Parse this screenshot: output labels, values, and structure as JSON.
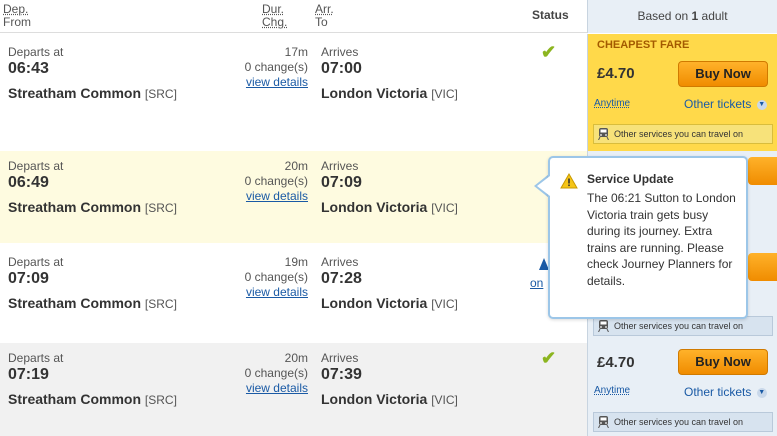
{
  "header": {
    "dep_abbr": "Dep.",
    "from": "From",
    "dur_abbr": "Dur.",
    "chg_abbr": "Chg.",
    "arr_abbr": "Arr.",
    "to": "To",
    "status": "Status",
    "fare_prefix": "Based on ",
    "fare_count": "1",
    "fare_suffix": " adult"
  },
  "rows": [
    {
      "departs_label": "Departs at",
      "dep_time": "06:43",
      "dep_station": "Streatham Common",
      "dep_code": "[SRC]",
      "duration": "17m",
      "changes": "0 change(s)",
      "view_details": "view details",
      "arrives_label": "Arrives",
      "arr_time": "07:00",
      "arr_station": "London Victoria",
      "arr_code": "[VIC]",
      "status_icon": "check-icon",
      "status_symbol": "✔"
    },
    {
      "departs_label": "Departs at",
      "dep_time": "06:49",
      "dep_station": "Streatham Common",
      "dep_code": "[SRC]",
      "duration": "20m",
      "changes": "0 change(s)",
      "view_details": "view details",
      "arrives_label": "Arrives",
      "arr_time": "07:09",
      "arr_station": "London Victoria",
      "arr_code": "[VIC]"
    },
    {
      "departs_label": "Departs at",
      "dep_time": "07:09",
      "dep_station": "Streatham Common",
      "dep_code": "[SRC]",
      "duration": "19m",
      "changes": "0 change(s)",
      "view_details": "view details",
      "arrives_label": "Arrives",
      "arr_time": "07:28",
      "arr_station": "London Victoria",
      "arr_code": "[VIC]",
      "status_link_partial": "on"
    },
    {
      "departs_label": "Departs at",
      "dep_time": "07:19",
      "dep_station": "Streatham Common",
      "dep_code": "[SRC]",
      "duration": "20m",
      "changes": "0 change(s)",
      "view_details": "view details",
      "arrives_label": "Arrives",
      "arr_time": "07:39",
      "arr_station": "London Victoria",
      "arr_code": "[VIC]",
      "status_icon": "check-icon",
      "status_symbol": "✔"
    }
  ],
  "fares": [
    {
      "badge": "CHEAPEST FARE",
      "price": "£4.70",
      "buy_label": "Buy Now",
      "anytime": "Anytime",
      "other_tickets": "Other tickets",
      "services": "Other services you can travel on"
    },
    {
      "services": "Other services you can travel on"
    },
    {
      "price": "£4.70",
      "buy_label": "Buy Now",
      "anytime": "Anytime",
      "other_tickets": "Other tickets",
      "services": "Other services you can travel on"
    }
  ],
  "popup": {
    "title": "Service Update",
    "body": "The 06:21 Sutton to London Victoria train gets busy during its journey. Extra trains are running. Please check Journey Planners for details.",
    "icon": "warning-icon"
  },
  "colors": {
    "row_highlight": "#fefbe0",
    "row_grey": "#f1f1f1",
    "cheapest_bg": "#ffd94a",
    "fare_bg": "#e8eff6",
    "buy_button": "#f8a10f",
    "link": "#1a5aa5",
    "check": "#8cb520"
  }
}
